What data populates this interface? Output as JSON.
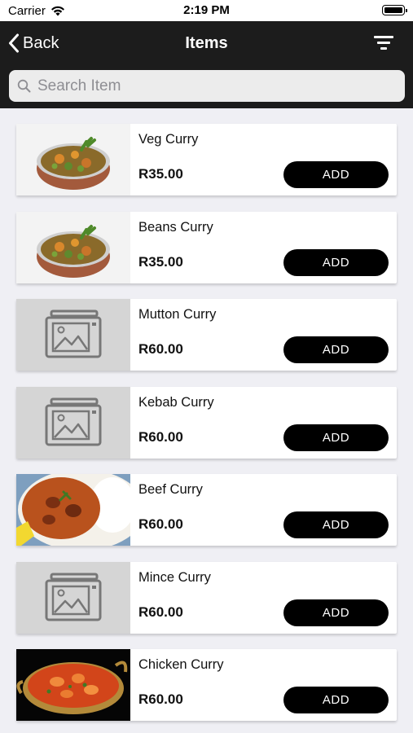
{
  "status_bar": {
    "carrier": "Carrier",
    "time": "2:19 PM"
  },
  "nav": {
    "back_label": "Back",
    "title": "Items"
  },
  "search": {
    "placeholder": "Search Item"
  },
  "items": [
    {
      "name": "Veg Curry",
      "price": "R35.00",
      "add_label": "ADD",
      "image": "veg-curry-bowl"
    },
    {
      "name": "Beans Curry",
      "price": "R35.00",
      "add_label": "ADD",
      "image": "veg-curry-bowl"
    },
    {
      "name": "Mutton Curry",
      "price": "R60.00",
      "add_label": "ADD",
      "image": "placeholder-image-icon"
    },
    {
      "name": "Kebab Curry",
      "price": "R60.00",
      "add_label": "ADD",
      "image": "placeholder-image-icon"
    },
    {
      "name": "Beef Curry",
      "price": "R60.00",
      "add_label": "ADD",
      "image": "beef-curry-rice-plate"
    },
    {
      "name": "Mince Curry",
      "price": "R60.00",
      "add_label": "ADD",
      "image": "placeholder-image-icon"
    },
    {
      "name": "Chicken Curry",
      "price": "R60.00",
      "add_label": "ADD",
      "image": "chicken-curry-pan"
    }
  ],
  "colors": {
    "nav_bg": "#1c1c1c",
    "button_bg": "#000000",
    "page_bg": "#efeff4",
    "placeholder_bg": "#d5d5d5"
  }
}
